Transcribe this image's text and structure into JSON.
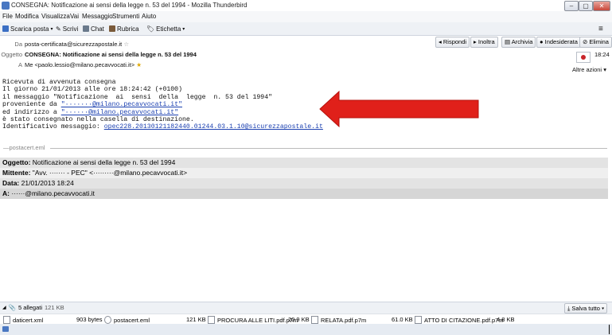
{
  "window": {
    "title": "CONSEGNA: Notificazione ai sensi della legge n. 53 del 1994 - Mozilla Thunderbird",
    "min": "–",
    "max": "▢",
    "close": "✕"
  },
  "menu": [
    "File",
    "Modifica",
    "Visualizza",
    "Vai",
    "Messaggio",
    "Strumenti",
    "Aiuto"
  ],
  "toolbar": {
    "get_mail": "Scarica posta",
    "write": "Scrivi",
    "chat": "Chat",
    "address_book": "Rubrica",
    "tag": "Etichetta"
  },
  "header": {
    "from_label": "Da",
    "from_value": "posta-certificata@sicurezzapostale.it",
    "subject_label": "Oggetto",
    "subject_value": "CONSEGNA: Notificazione ai sensi della legge n. 53 del 1994",
    "to_label": "A",
    "to_value": "Me <paolo.lessio@milano.pecavvocati.it>",
    "time": "18:24",
    "other_actions": "Altre azioni",
    "buttons": {
      "reply": "Rispondi",
      "forward": "Inoltra",
      "archive": "Archivia",
      "junk": "Indesiderata",
      "delete": "Elimina"
    }
  },
  "body": {
    "line1": "Ricevuta di avvenuta consegna",
    "line2": "Il giorno 21/01/2013 alle ore 18:24:42 (+0100)",
    "line3": "il messaggio \"Notificazione  ai  sensi  della  legge  n. 53 del 1994\"",
    "line4_prefix": "proveniente da ",
    "line4_link": "\"·······@milano.pecavvocati.it\"",
    "line5_prefix": "ed indirizzo a ",
    "line5_link": "\"······@milano.pecavvocati.it\"",
    "line6": "è stato consegnato nella casella di destinazione.",
    "line7_prefix": "Identificativo messaggio: ",
    "line7_link": "opec228.20130121182440.01244.03.1.10@sicurezzapostale.it"
  },
  "postacert": {
    "separator": "postacert.eml",
    "subject_label": "Oggetto:",
    "subject_value": "Notificazione ai sensi della legge n. 53 del 1994",
    "sender_label": "Mittente:",
    "sender_value": "\"Avv. ······· - PEC\" <·········@milano.pecavvocati.it>",
    "date_label": "Data:",
    "date_value": "21/01/2013 18:24",
    "to_label": "A:",
    "to_value": "······@milano.pecavvocati.it"
  },
  "attachments": {
    "summary": "5 allegati",
    "total_size": "121 KB",
    "save_all": "Salva tutto",
    "items": [
      {
        "name": "daticert.xml",
        "size": "903 bytes"
      },
      {
        "name": "postacert.eml",
        "size": "121 KB"
      },
      {
        "name": "PROCURA ALLE LITI.pdf.p7m",
        "size": "20.9 KB"
      },
      {
        "name": "RELATA.pdf.p7m",
        "size": "61.0 KB"
      },
      {
        "name": "ATTO DI CITAZIONE.pdf.p7m",
        "size": "4.8 KB"
      }
    ]
  },
  "colors": {
    "arrow": "#e0201a",
    "link": "#1a3fb0",
    "field_bg": "#e3e3e3"
  }
}
